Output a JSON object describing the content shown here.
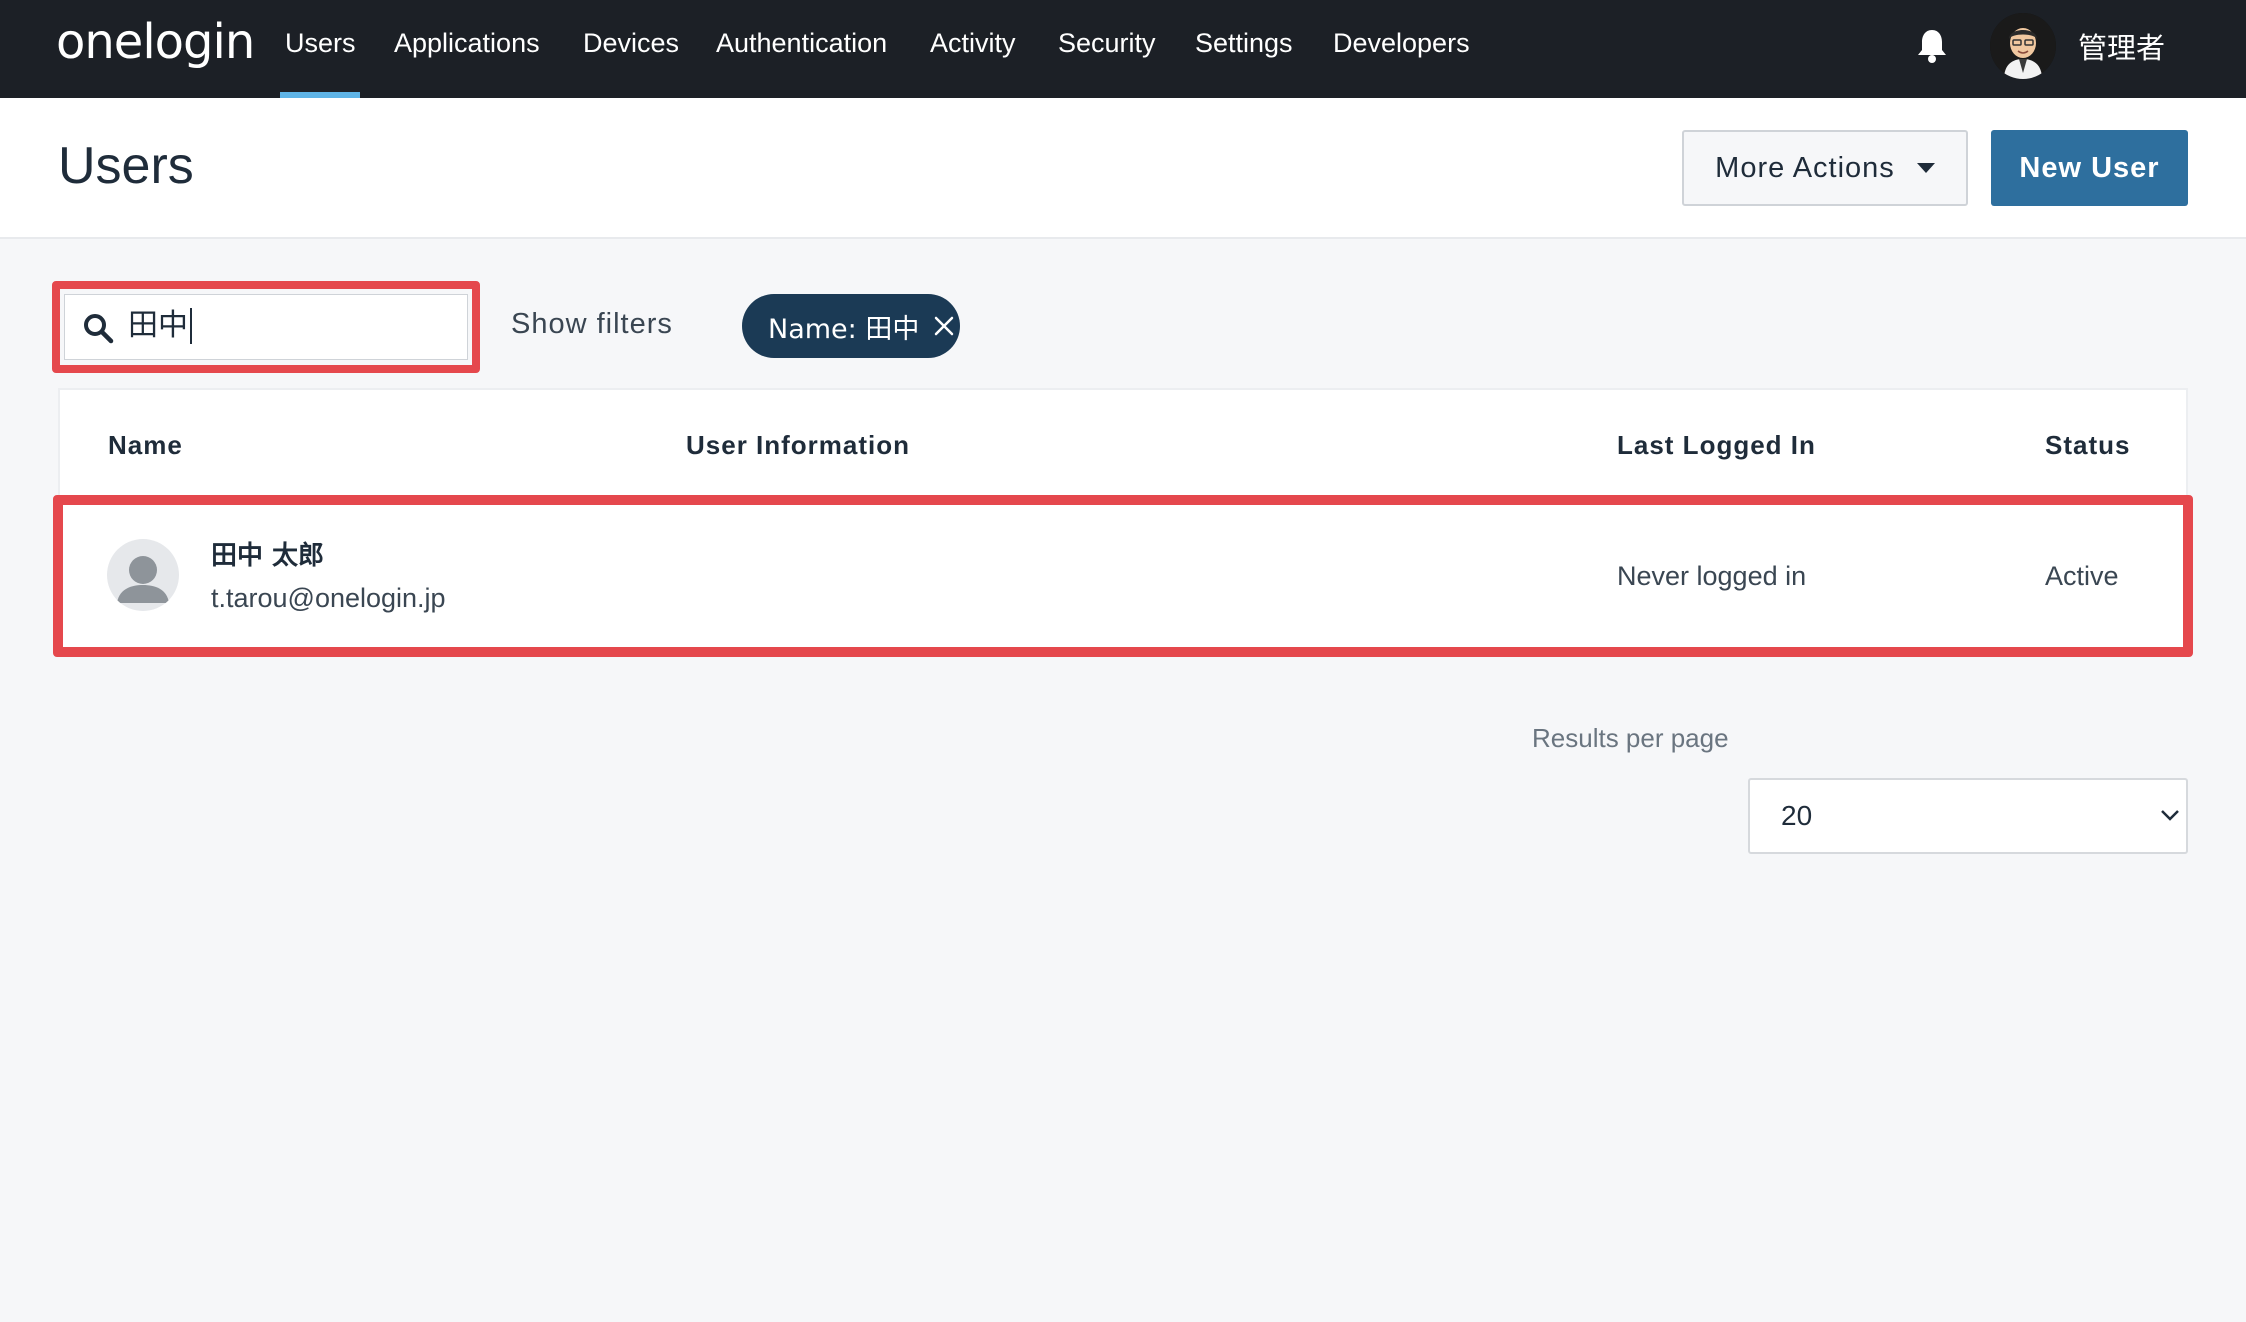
{
  "topnav": {
    "logo": "onelogin",
    "items": [
      {
        "label": "Users",
        "active": true
      },
      {
        "label": "Applications"
      },
      {
        "label": "Devices"
      },
      {
        "label": "Authentication"
      },
      {
        "label": "Activity"
      },
      {
        "label": "Security"
      },
      {
        "label": "Settings"
      },
      {
        "label": "Developers"
      }
    ],
    "notification_icon": "bell-icon",
    "admin_name": "管理者"
  },
  "header": {
    "title": "Users",
    "more_actions_label": "More Actions",
    "new_user_label": "New User"
  },
  "search": {
    "value": "田中",
    "icon": "search-icon",
    "show_filters_label": "Show filters",
    "active_filter_chip": "Name: 田中"
  },
  "table": {
    "columns": [
      "Name",
      "User Information",
      "Last Logged In",
      "Status"
    ],
    "rows": [
      {
        "name": "田中 太郎",
        "email": "t.tarou@onelogin.jp",
        "last_logged_in": "Never logged in",
        "status": "Active"
      }
    ]
  },
  "pagination": {
    "results_per_page_label": "Results per page",
    "results_per_page": "20"
  },
  "colors": {
    "nav_bg": "#1c2026",
    "active_underline": "#5fb4e6",
    "primary_button": "#2e6f9e",
    "chip_bg": "#1b3a55",
    "highlight": "#e5484d"
  }
}
